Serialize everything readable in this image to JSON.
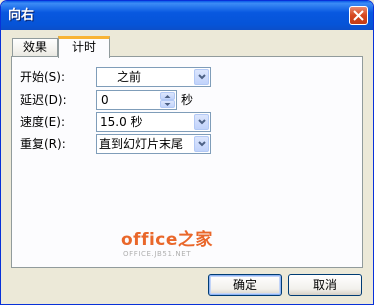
{
  "window": {
    "title": "向右"
  },
  "tabs": [
    {
      "label": "效果",
      "active": false
    },
    {
      "label": "计时",
      "active": true
    }
  ],
  "fields": {
    "start": {
      "label": "开始(S):",
      "value": "之前"
    },
    "delay": {
      "label": "延迟(D):",
      "value": "0",
      "unit": "秒"
    },
    "speed": {
      "label": "速度(E):",
      "value": "15.0 秒"
    },
    "repeat": {
      "label": "重复(R):",
      "value": "直到幻灯片末尾"
    }
  },
  "watermark": {
    "main": "office之家",
    "sub": "OFFICE.JB51.NET"
  },
  "buttons": {
    "ok": "确定",
    "cancel": "取消"
  },
  "icons": {
    "close": "close-icon",
    "dropdown": "chevron-down-icon",
    "spin_up": "chevron-up-icon",
    "spin_down": "chevron-down-icon"
  },
  "colors": {
    "titlebar": "#0858e0",
    "close_button": "#d6471f",
    "active_tab_accent": "#f8b334",
    "watermark": "#e9672a"
  }
}
